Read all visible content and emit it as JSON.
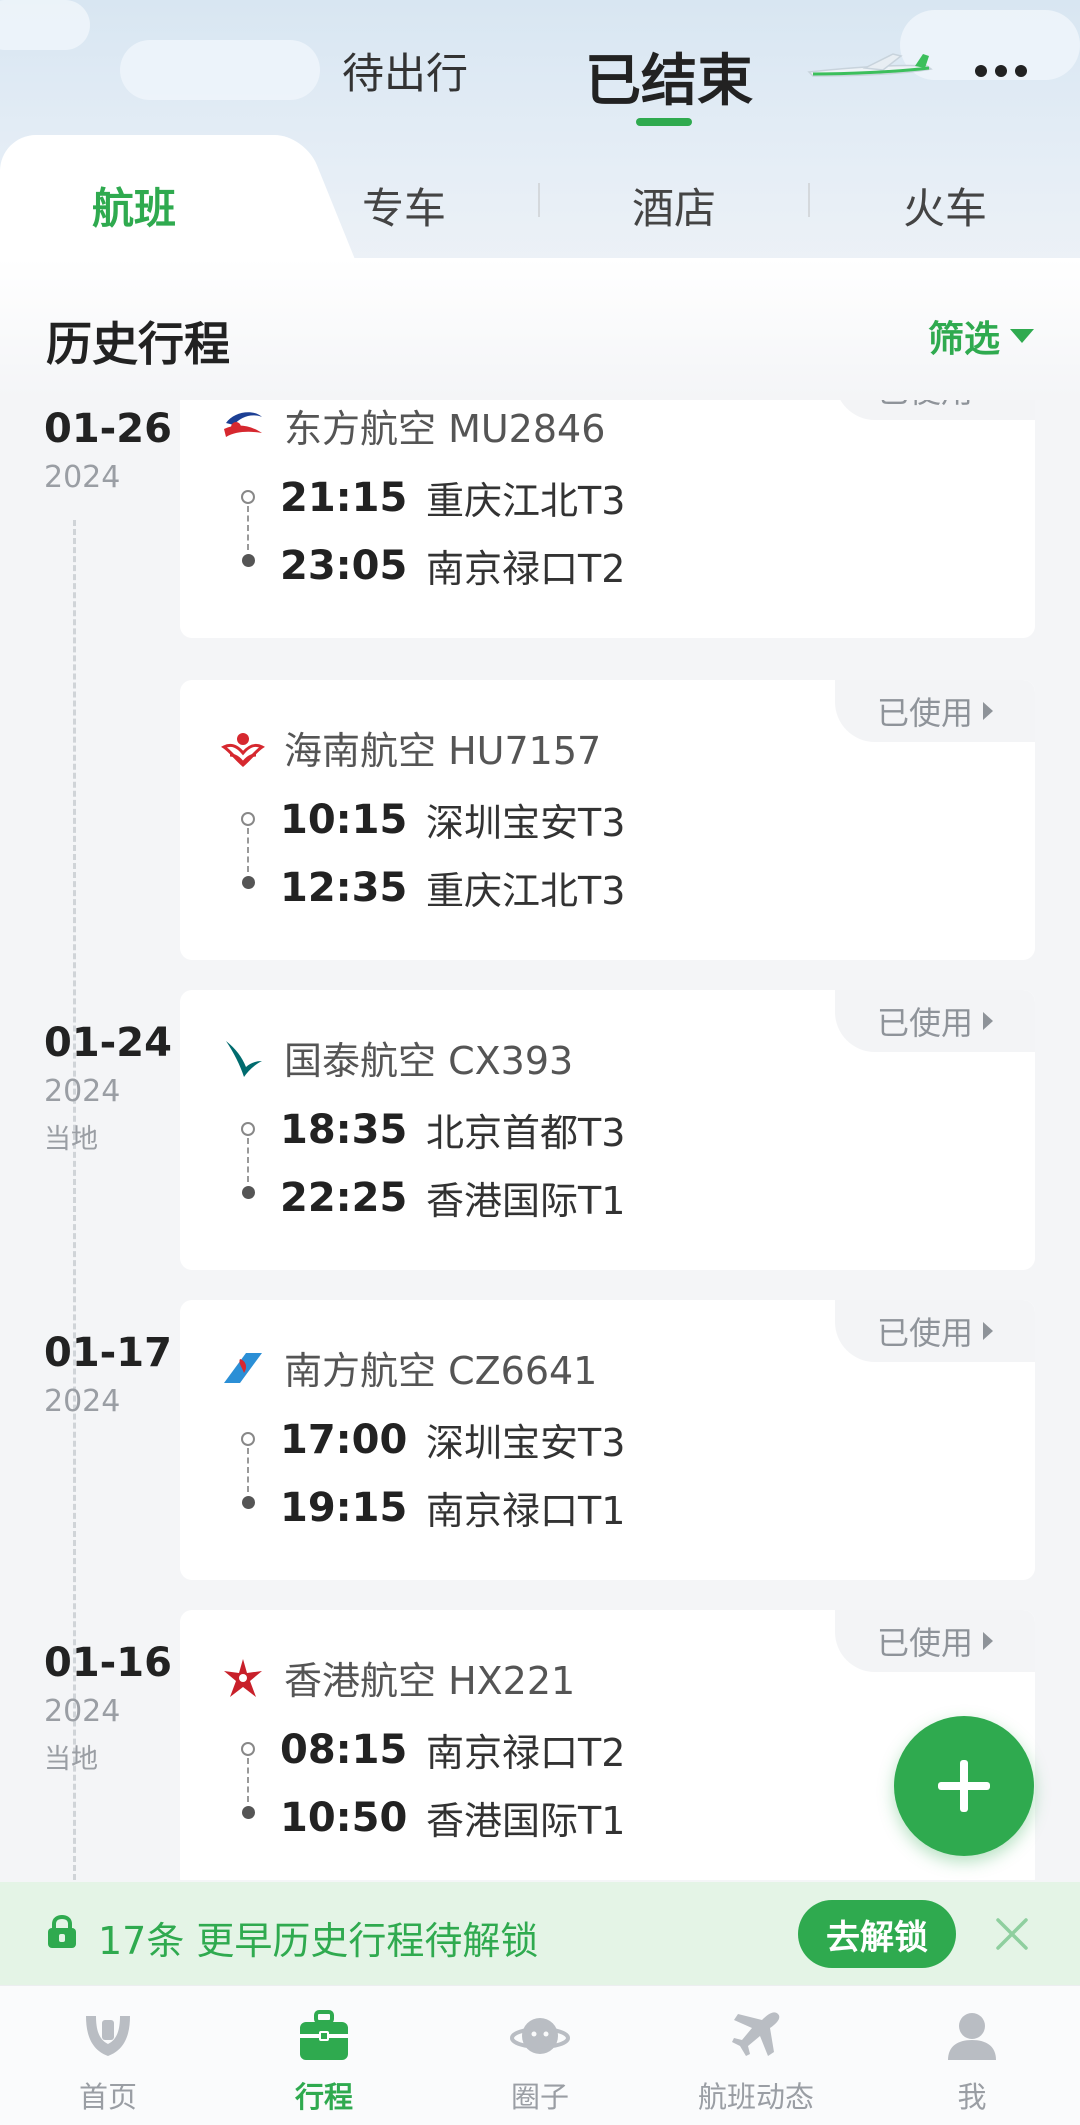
{
  "header": {
    "segment_pending": "待出行",
    "segment_ended": "已结束"
  },
  "tabs": [
    {
      "label": "航班",
      "active": true
    },
    {
      "label": "专车",
      "active": false
    },
    {
      "label": "酒店",
      "active": false
    },
    {
      "label": "火车",
      "active": false
    }
  ],
  "section": {
    "title": "历史行程",
    "filter_label": "筛选"
  },
  "used_label": "已使用",
  "trips": [
    {
      "date": "01-26",
      "year": "2024",
      "local": "",
      "airline": "东方航空 MU2846",
      "logo": "china-eastern-logo",
      "dep_time": "21:15",
      "dep_airport": "重庆江北T3",
      "arr_time": "23:05",
      "arr_airport": "南京禄口T2"
    },
    {
      "date": "",
      "year": "",
      "local": "",
      "airline": "海南航空 HU7157",
      "logo": "hainan-airlines-logo",
      "dep_time": "10:15",
      "dep_airport": "深圳宝安T3",
      "arr_time": "12:35",
      "arr_airport": "重庆江北T3"
    },
    {
      "date": "01-24",
      "year": "2024",
      "local": "当地",
      "airline": "国泰航空 CX393",
      "logo": "cathay-pacific-logo",
      "dep_time": "18:35",
      "dep_airport": "北京首都T3",
      "arr_time": "22:25",
      "arr_airport": "香港国际T1"
    },
    {
      "date": "01-17",
      "year": "2024",
      "local": "",
      "airline": "南方航空 CZ6641",
      "logo": "china-southern-logo",
      "dep_time": "17:00",
      "dep_airport": "深圳宝安T3",
      "arr_time": "19:15",
      "arr_airport": "南京禄口T1"
    },
    {
      "date": "01-16",
      "year": "2024",
      "local": "当地",
      "airline": "香港航空 HX221",
      "logo": "hong-kong-airlines-logo",
      "dep_time": "08:15",
      "dep_airport": "南京禄口T2",
      "arr_time": "10:50",
      "arr_airport": "香港国际T1"
    }
  ],
  "unlock_bar": {
    "text": "17条 更早历史行程待解锁",
    "button": "去解锁"
  },
  "tabbar": [
    {
      "label": "首页",
      "icon": "home-icon",
      "active": false
    },
    {
      "label": "行程",
      "icon": "suitcase-icon",
      "active": true
    },
    {
      "label": "圈子",
      "icon": "planet-icon",
      "active": false
    },
    {
      "label": "航班动态",
      "icon": "plane-icon",
      "active": false
    },
    {
      "label": "我",
      "icon": "profile-icon",
      "active": false
    }
  ],
  "colors": {
    "accent": "#2faa4f",
    "background": "#f4f5f7",
    "unlock_bar_bg": "#e4f4e6"
  }
}
